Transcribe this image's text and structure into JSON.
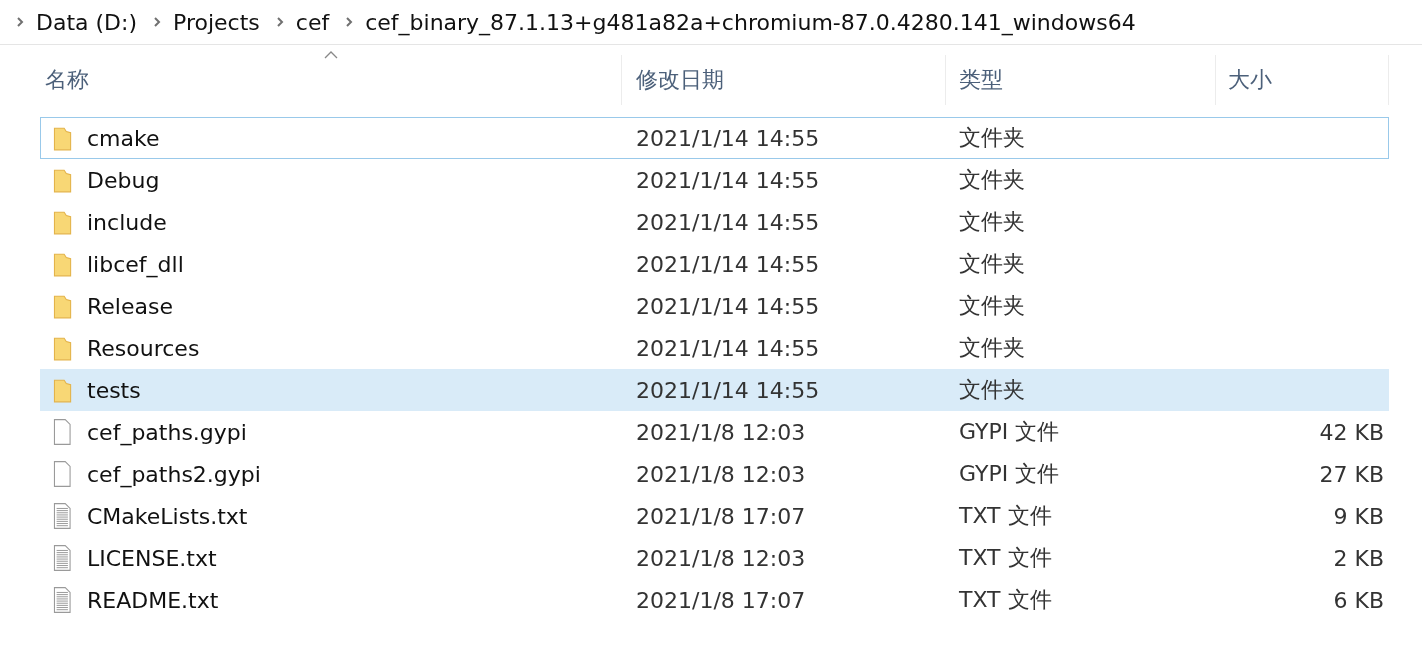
{
  "breadcrumb": [
    "Data (D:)",
    "Projects",
    "cef",
    "cef_binary_87.1.13+g481a82a+chromium-87.0.4280.141_windows64"
  ],
  "table": {
    "columns": [
      {
        "label": "名称",
        "sorted": true
      },
      {
        "label": "修改日期",
        "sorted": false
      },
      {
        "label": "类型",
        "sorted": false
      },
      {
        "label": "大小",
        "sorted": false
      }
    ],
    "rows": [
      {
        "kind": "folder",
        "name": "cmake",
        "modified": "2021/1/14 14:55",
        "type": "文件夹",
        "focused": true,
        "selected": false
      },
      {
        "kind": "folder",
        "name": "Debug",
        "modified": "2021/1/14 14:55",
        "type": "文件夹",
        "focused": false,
        "selected": false
      },
      {
        "kind": "folder",
        "name": "include",
        "modified": "2021/1/14 14:55",
        "type": "文件夹",
        "focused": false,
        "selected": false
      },
      {
        "kind": "folder",
        "name": "libcef_dll",
        "modified": "2021/1/14 14:55",
        "type": "文件夹",
        "focused": false,
        "selected": false
      },
      {
        "kind": "folder",
        "name": "Release",
        "modified": "2021/1/14 14:55",
        "type": "文件夹",
        "focused": false,
        "selected": false
      },
      {
        "kind": "folder",
        "name": "Resources",
        "modified": "2021/1/14 14:55",
        "type": "文件夹",
        "focused": false,
        "selected": false
      },
      {
        "kind": "folder",
        "name": "tests",
        "modified": "2021/1/14 14:55",
        "type": "文件夹",
        "focused": false,
        "selected": true
      },
      {
        "kind": "file",
        "name": "cef_paths.gypi",
        "modified": "2021/1/8 12:03",
        "type": "GYPI 文件",
        "size": "42 KB",
        "focused": false,
        "selected": false
      },
      {
        "kind": "file",
        "name": "cef_paths2.gypi",
        "modified": "2021/1/8 12:03",
        "type": "GYPI 文件",
        "size": "27 KB",
        "focused": false,
        "selected": false
      },
      {
        "kind": "text",
        "name": "CMakeLists.txt",
        "modified": "2021/1/8 17:07",
        "type": "TXT 文件",
        "size": "9 KB",
        "focused": false,
        "selected": false
      },
      {
        "kind": "text",
        "name": "LICENSE.txt",
        "modified": "2021/1/8 12:03",
        "type": "TXT 文件",
        "size": "2 KB",
        "focused": false,
        "selected": false
      },
      {
        "kind": "text",
        "name": "README.txt",
        "modified": "2021/1/8 17:07",
        "type": "TXT 文件",
        "size": "6 KB",
        "focused": false,
        "selected": false
      }
    ]
  }
}
